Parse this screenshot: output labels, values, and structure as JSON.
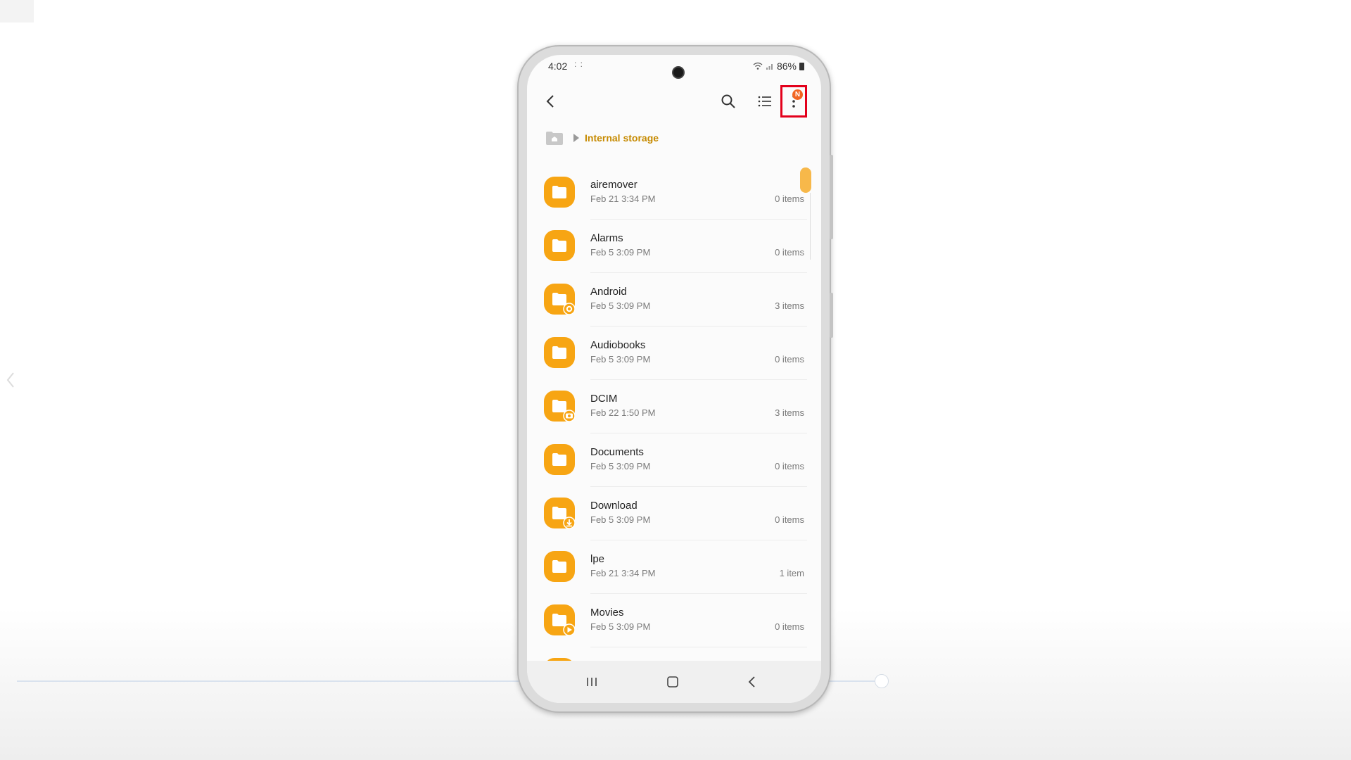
{
  "status_bar": {
    "time": "4:02",
    "notif_dots": ": :",
    "battery": "86%"
  },
  "toolbar": {
    "back_icon": "back-arrow-icon",
    "search_icon": "search-icon",
    "list_icon": "list-view-icon",
    "more_icon": "more-vertical-icon",
    "badge": "N"
  },
  "breadcrumb": {
    "home_icon": "home-folder-icon",
    "label": "Internal storage"
  },
  "files": [
    {
      "name": "airemover",
      "date": "Feb 21 3:34 PM",
      "count": "0 items",
      "overlay": ""
    },
    {
      "name": "Alarms",
      "date": "Feb 5 3:09 PM",
      "count": "0 items",
      "overlay": ""
    },
    {
      "name": "Android",
      "date": "Feb 5 3:09 PM",
      "count": "3 items",
      "overlay": "gear-icon"
    },
    {
      "name": "Audiobooks",
      "date": "Feb 5 3:09 PM",
      "count": "0 items",
      "overlay": ""
    },
    {
      "name": "DCIM",
      "date": "Feb 22 1:50 PM",
      "count": "3 items",
      "overlay": "camera-icon"
    },
    {
      "name": "Documents",
      "date": "Feb 5 3:09 PM",
      "count": "0 items",
      "overlay": ""
    },
    {
      "name": "Download",
      "date": "Feb 5 3:09 PM",
      "count": "0 items",
      "overlay": "download-icon"
    },
    {
      "name": "lpe",
      "date": "Feb 21 3:34 PM",
      "count": "1 item",
      "overlay": ""
    },
    {
      "name": "Movies",
      "date": "Feb 5 3:09 PM",
      "count": "0 items",
      "overlay": "play-icon"
    }
  ],
  "nav": {
    "recents_icon": "recents-icon",
    "home_icon": "home-icon",
    "back_icon": "back-icon"
  },
  "colors": {
    "folder": "#f7a513",
    "accent": "#c68a00",
    "highlight": "#e3001b",
    "badge": "#f26522"
  }
}
